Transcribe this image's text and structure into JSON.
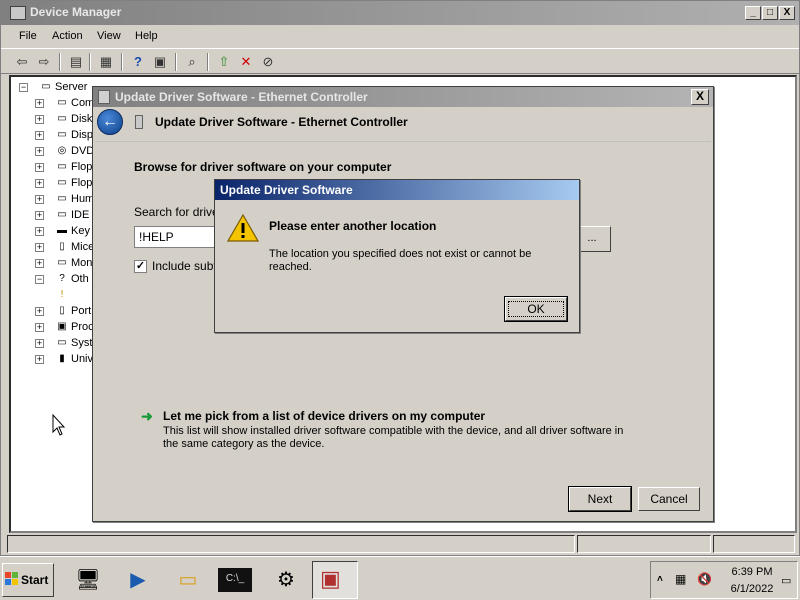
{
  "device_manager": {
    "title": "Device Manager",
    "window_controls": {
      "minimize": "_",
      "maximize": "□",
      "close": "X"
    },
    "menu": [
      "File",
      "Action",
      "View",
      "Help"
    ],
    "tree": {
      "root": "Server",
      "items": [
        "Com",
        "Disk",
        "Disp",
        "DVD",
        "Flop",
        "Flop",
        "Hum",
        "IDE",
        "Key",
        "Mice",
        "Mon",
        "Oth",
        "",
        "Port",
        "Proc",
        "Syst",
        "Univ"
      ]
    }
  },
  "wizard": {
    "title": "Update Driver Software - Ethernet Controller",
    "header_title": "Update Driver Software - Ethernet Controller",
    "browse_heading": "Browse for driver software on your computer",
    "search_label": "Search for drive",
    "search_value": "!HELP",
    "browse_button": "...",
    "include_label": "Include subt",
    "include_checked": true,
    "pick_title": "Let me pick from a list of device drivers on my computer",
    "pick_description": "This list will show installed driver software compatible with the device, and all driver software in the same category as the device.",
    "next_button": "Next",
    "cancel_button": "Cancel",
    "close_glyph": "X"
  },
  "alert": {
    "title": "Update Driver Software",
    "heading": "Please enter another location",
    "message": "The location you specified does not exist or cannot be reached.",
    "ok_button": "OK"
  },
  "taskbar": {
    "start_label": "Start",
    "clock_time": "6:39 PM",
    "clock_date": "6/1/2022"
  },
  "colors": {
    "alert_titlebar": "#0a246a",
    "inactive_titlebar": "#808080",
    "pick_arrow": "#1a9a3a",
    "back_button": "#1a5bb0"
  }
}
